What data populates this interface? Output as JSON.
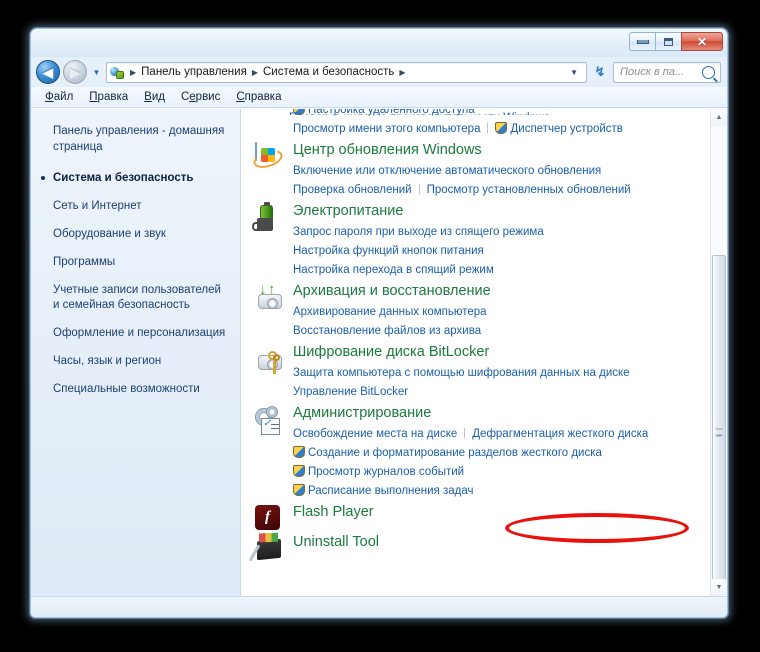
{
  "window": {
    "controls": {
      "minimize": "minimize",
      "maximize": "maximize",
      "close": "✕"
    }
  },
  "navbar": {
    "back_label": "◀",
    "forward_label": "▶",
    "history_dropdown": "▼",
    "breadcrumbs": [
      "Панель управления",
      "Система и безопасность"
    ],
    "separator": "▶",
    "address_dropdown": "▼",
    "refresh_label": "↯",
    "search_placeholder": "Поиск в па..."
  },
  "menubar": {
    "items": [
      {
        "pre": "",
        "key": "Ф",
        "post": "айл"
      },
      {
        "pre": "",
        "key": "П",
        "post": "равка"
      },
      {
        "pre": "",
        "key": "В",
        "post": "ид"
      },
      {
        "pre": "С",
        "key": "е",
        "post": "рвис"
      },
      {
        "pre": "",
        "key": "С",
        "post": "правка"
      }
    ]
  },
  "sidebar": {
    "home": "Панель управления - домашняя страница",
    "items": [
      {
        "label": "Система и безопасность",
        "active": true
      },
      {
        "label": "Сеть и Интернет",
        "active": false
      },
      {
        "label": "Оборудование и звук",
        "active": false
      },
      {
        "label": "Программы",
        "active": false
      },
      {
        "label": "Учетные записи пользователей и семейная безопасность",
        "active": false
      },
      {
        "label": "Оформление и персонализация",
        "active": false
      },
      {
        "label": "Часы, язык и регион",
        "active": false
      },
      {
        "label": "Специальные возможности",
        "active": false
      }
    ]
  },
  "main": {
    "clipped_top_link": "Проверка индекса производительности Windows",
    "categories": [
      {
        "icon": "system-icon",
        "title": "",
        "lines": [
          [
            {
              "text": "Настройка удаленного доступа",
              "shield": true
            }
          ],
          [
            {
              "text": "Просмотр имени этого компьютера",
              "shield": false
            },
            {
              "text": "Диспетчер устройств",
              "shield": true
            }
          ]
        ]
      },
      {
        "icon": "windows-update-icon",
        "title": "Центр обновления Windows",
        "lines": [
          [
            {
              "text": "Включение или отключение автоматического обновления",
              "shield": false
            }
          ],
          [
            {
              "text": "Проверка обновлений",
              "shield": false
            },
            {
              "text": "Просмотр установленных обновлений",
              "shield": false
            }
          ]
        ]
      },
      {
        "icon": "power-icon",
        "title": "Электропитание",
        "lines": [
          [
            {
              "text": "Запрос пароля при выходе из спящего режима",
              "shield": false
            }
          ],
          [
            {
              "text": "Настройка функций кнопок питания",
              "shield": false
            }
          ],
          [
            {
              "text": "Настройка перехода в спящий режим",
              "shield": false
            }
          ]
        ]
      },
      {
        "icon": "backup-restore-icon",
        "title": "Архивация и восстановление",
        "lines": [
          [
            {
              "text": "Архивирование данных компьютера",
              "shield": false
            }
          ],
          [
            {
              "text": "Восстановление файлов из архива",
              "shield": false
            }
          ]
        ]
      },
      {
        "icon": "bitlocker-icon",
        "title": "Шифрование диска BitLocker",
        "lines": [
          [
            {
              "text": "Защита компьютера с помощью шифрования данных на диске",
              "shield": false
            }
          ],
          [
            {
              "text": "Управление BitLocker",
              "shield": false
            }
          ]
        ]
      },
      {
        "icon": "administrative-tools-icon",
        "title": "Администрирование",
        "highlighted": true,
        "lines": [
          [
            {
              "text": "Освобождение места на диске",
              "shield": false
            },
            {
              "text": "Дефрагментация жесткого диска",
              "shield": false
            }
          ],
          [
            {
              "text": "Создание и форматирование разделов жесткого диска",
              "shield": true
            }
          ],
          [
            {
              "text": "Просмотр журналов событий",
              "shield": true
            }
          ],
          [
            {
              "text": "Расписание выполнения задач",
              "shield": true
            }
          ]
        ]
      },
      {
        "icon": "flash-player-icon",
        "title": "Flash Player",
        "lines": []
      },
      {
        "icon": "uninstall-tool-icon",
        "title": "Uninstall Tool",
        "lines": []
      }
    ]
  },
  "scrollbar": {
    "up_arrow": "▲",
    "down_arrow": "▼"
  },
  "colors": {
    "heading_green": "#1b7a3e",
    "link_blue": "#1c5fa8",
    "highlight_red": "#e8120c",
    "sidebar_text": "#1c3f73"
  }
}
